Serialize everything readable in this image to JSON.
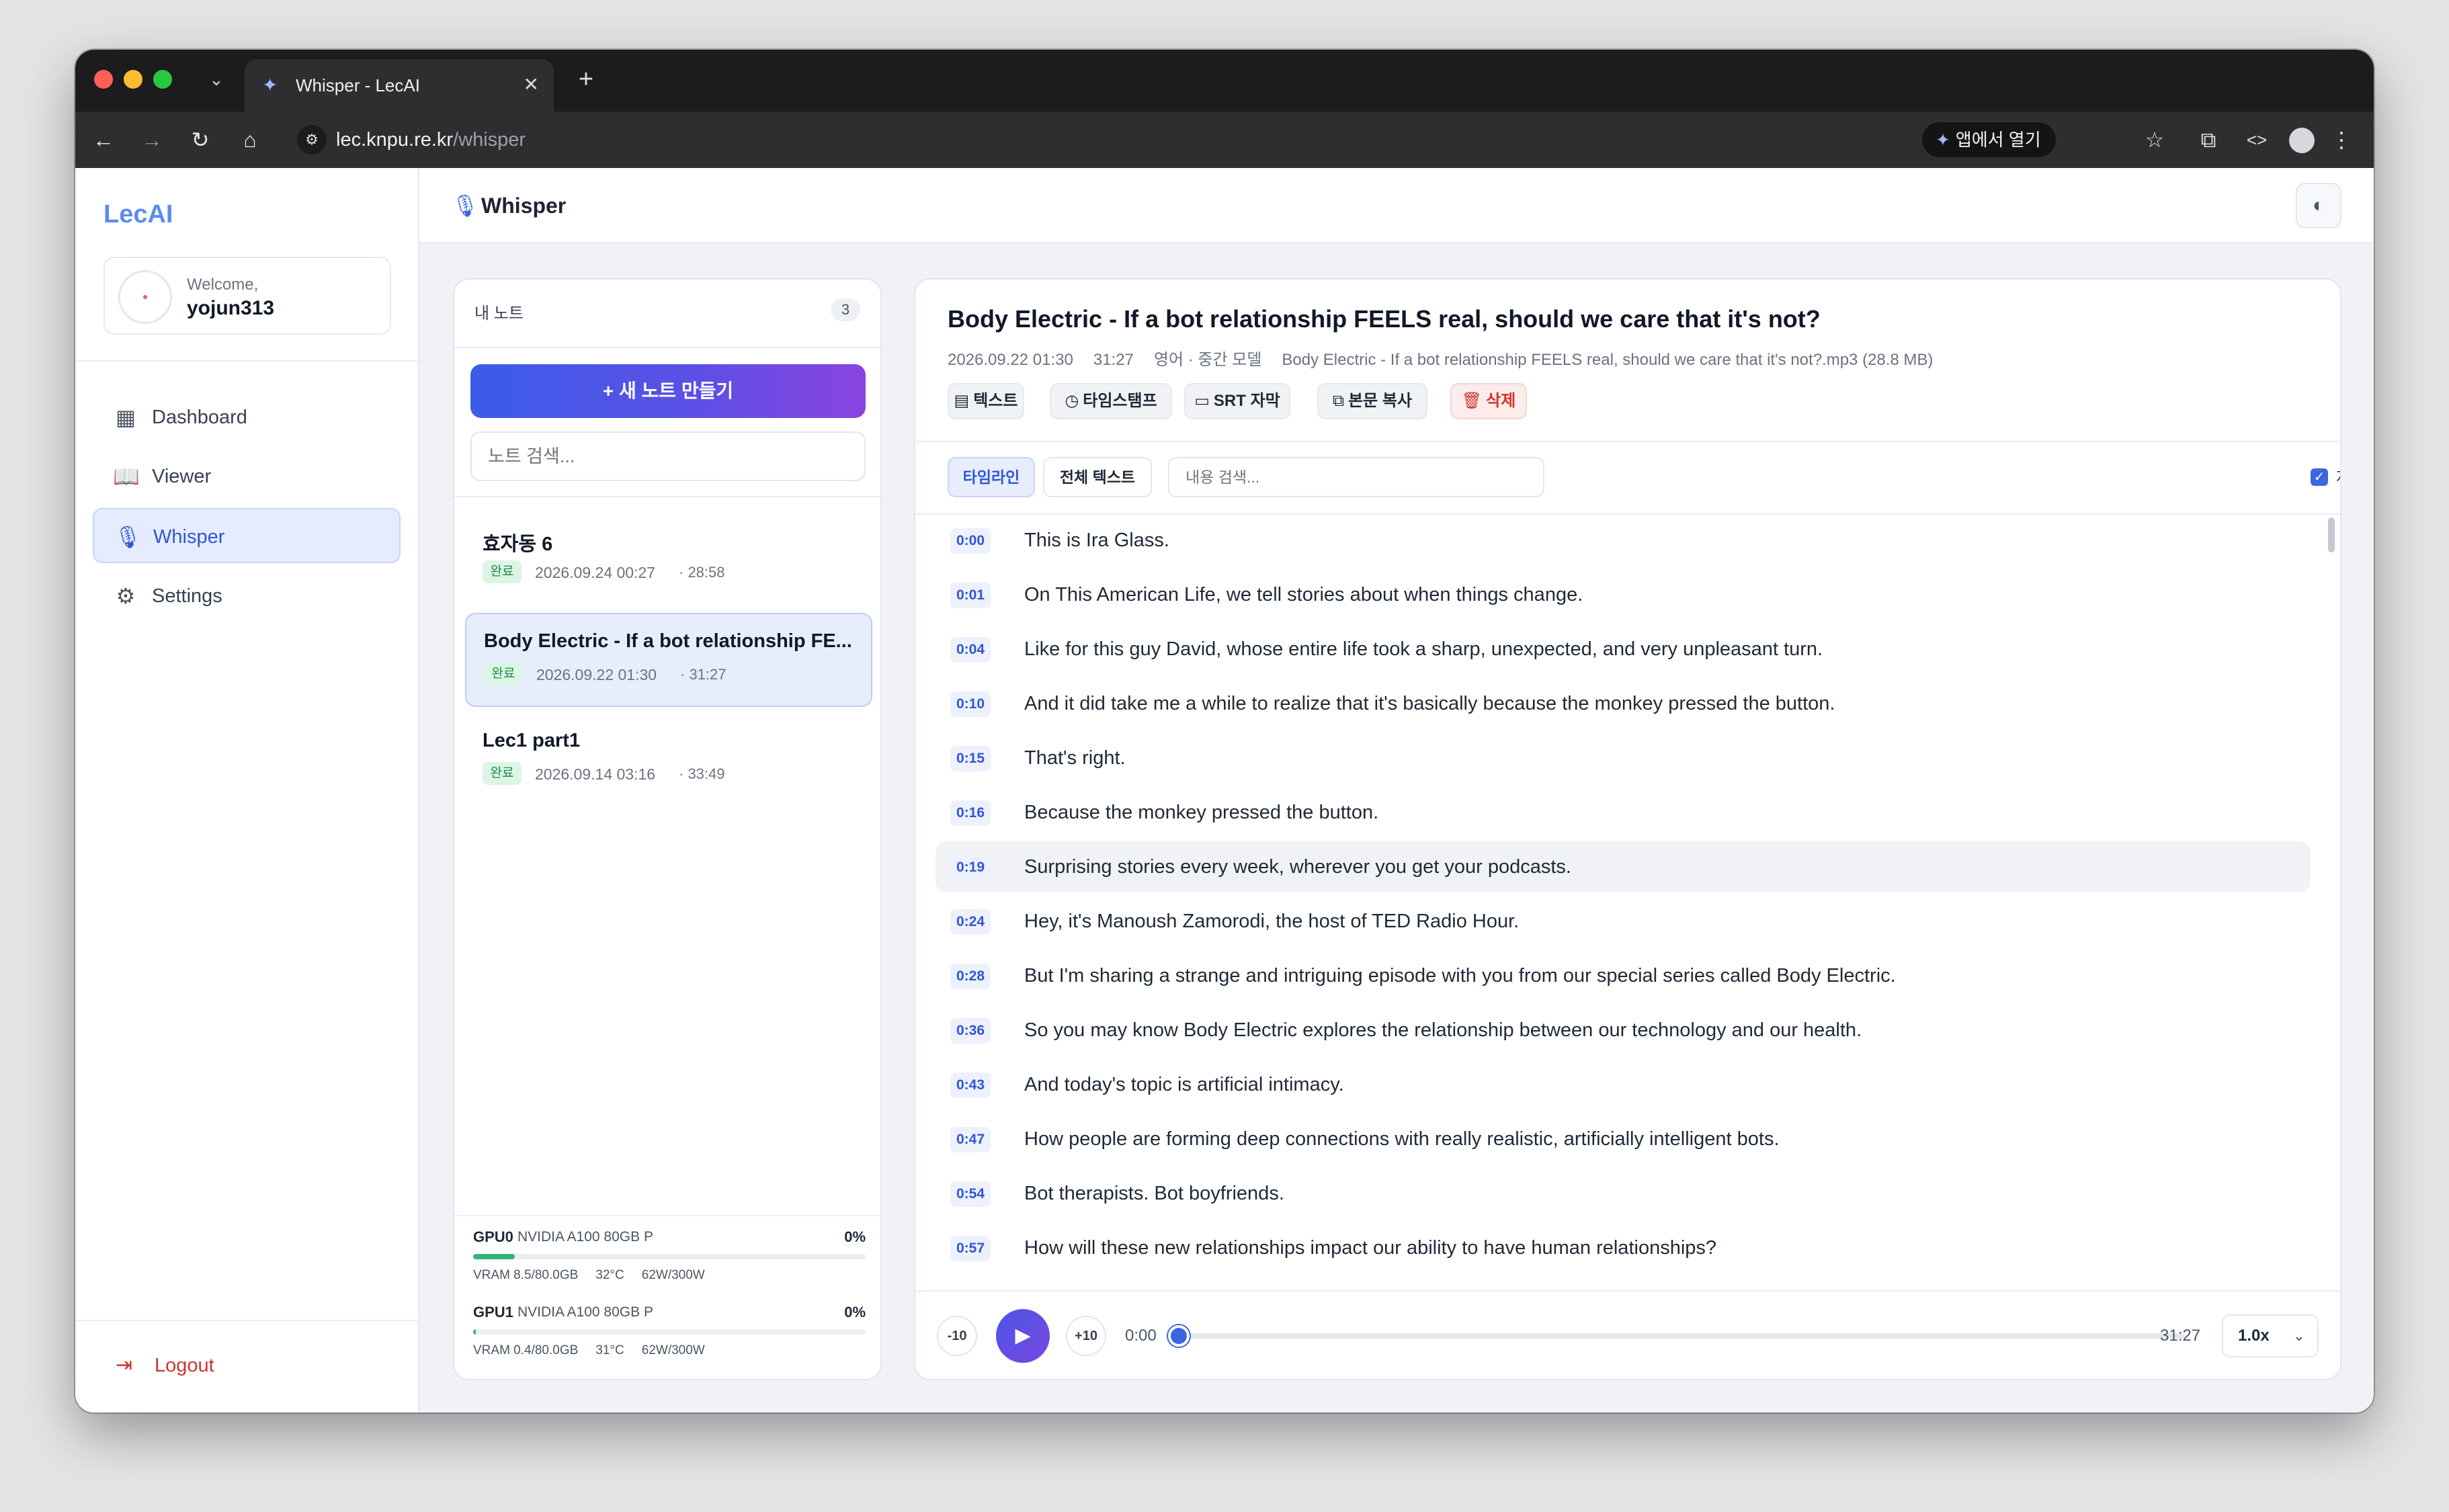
{
  "browser": {
    "tab_title": "Whisper - LecAI",
    "tab_close": "✕",
    "new_tab": "+",
    "url_domain": "lec.knpu.re.kr",
    "url_path": "/whisper",
    "open_app_label": "앱에서 열기"
  },
  "sidebar": {
    "brand": "LecAI",
    "welcome_label": "Welcome,",
    "username": "yojun313",
    "items": [
      {
        "label": "Dashboard",
        "icon": "dashboard-icon",
        "active": false
      },
      {
        "label": "Viewer",
        "icon": "book-icon",
        "active": false
      },
      {
        "label": "Whisper",
        "icon": "microphone-icon",
        "active": true
      },
      {
        "label": "Settings",
        "icon": "gear-icon",
        "active": false
      }
    ],
    "logout_label": "Logout"
  },
  "header": {
    "title": "Whisper"
  },
  "notes": {
    "heading": "내 노트",
    "count": "3",
    "new_note_label": "+ 새 노트 만들기",
    "search_placeholder": "노트 검색...",
    "items": [
      {
        "title": "효자동 6",
        "status": "완료",
        "date": "2026.09.24 00:27",
        "duration": "· 28:58",
        "selected": false
      },
      {
        "title": "Body Electric - If a bot relationship FE...",
        "status": "완료",
        "date": "2026.09.22 01:30",
        "duration": "· 31:27",
        "selected": true
      },
      {
        "title": "Lec1 part1",
        "status": "완료",
        "date": "2026.09.14 03:16",
        "duration": "· 33:49",
        "selected": false
      }
    ]
  },
  "gpus": [
    {
      "name": "GPU0",
      "model": "NVIDIA A100 80GB P",
      "util": "0%",
      "vram": "VRAM 8.5/80.0GB",
      "temp": "32°C",
      "power": "62W/300W",
      "vram_fraction": 0.106
    },
    {
      "name": "GPU1",
      "model": "NVIDIA A100 80GB P",
      "util": "0%",
      "vram": "VRAM 0.4/80.0GB",
      "temp": "31°C",
      "power": "62W/300W",
      "vram_fraction": 0.005
    }
  ],
  "transcript": {
    "title": "Body Electric - If a bot relationship FEELS real, should we care that it's not?",
    "date": "2026.09.22 01:30",
    "duration": "31:27",
    "language_model": "영어 · 중간 모델",
    "file": "Body Electric - If a bot relationship FEELS real, should we care that it's not?.mp3 (28.8 MB)",
    "actions": {
      "text": "텍스트",
      "timestamp": "타임스탬프",
      "srt": "SRT 자막",
      "copy": "본문 복사",
      "delete": "삭제"
    },
    "tabs": {
      "timeline": "타임라인",
      "full_text": "전체 텍스트"
    },
    "search_placeholder": "내용 검색...",
    "auto_scroll_label": "자동 스크롤",
    "lines": [
      {
        "time": "0:00",
        "text": "This is Ira Glass."
      },
      {
        "time": "0:01",
        "text": "On This American Life, we tell stories about when things change."
      },
      {
        "time": "0:04",
        "text": "Like for this guy David, whose entire life took a sharp, unexpected, and very unpleasant turn."
      },
      {
        "time": "0:10",
        "text": "And it did take me a while to realize that it's basically because the monkey pressed the button."
      },
      {
        "time": "0:15",
        "text": "That's right."
      },
      {
        "time": "0:16",
        "text": "Because the monkey pressed the button."
      },
      {
        "time": "0:19",
        "text": "Surprising stories every week, wherever you get your podcasts."
      },
      {
        "time": "0:24",
        "text": "Hey, it's Manoush Zamorodi, the host of TED Radio Hour."
      },
      {
        "time": "0:28",
        "text": "But I'm sharing a strange and intriguing episode with you from our special series called Body Electric."
      },
      {
        "time": "0:36",
        "text": "So you may know Body Electric explores the relationship between our technology and our health."
      },
      {
        "time": "0:43",
        "text": "And today's topic is artificial intimacy."
      },
      {
        "time": "0:47",
        "text": "How people are forming deep connections with really realistic, artificially intelligent bots."
      },
      {
        "time": "0:54",
        "text": "Bot therapists. Bot boyfriends."
      },
      {
        "time": "0:57",
        "text": "How will these new relationships impact our ability to have human relationships?"
      }
    ],
    "highlighted_index": 6
  },
  "player": {
    "back_label": "-10",
    "forward_label": "+10",
    "current_time": "0:00",
    "total_time": "31:27",
    "progress_fraction": 0,
    "speed": "1.0x"
  }
}
